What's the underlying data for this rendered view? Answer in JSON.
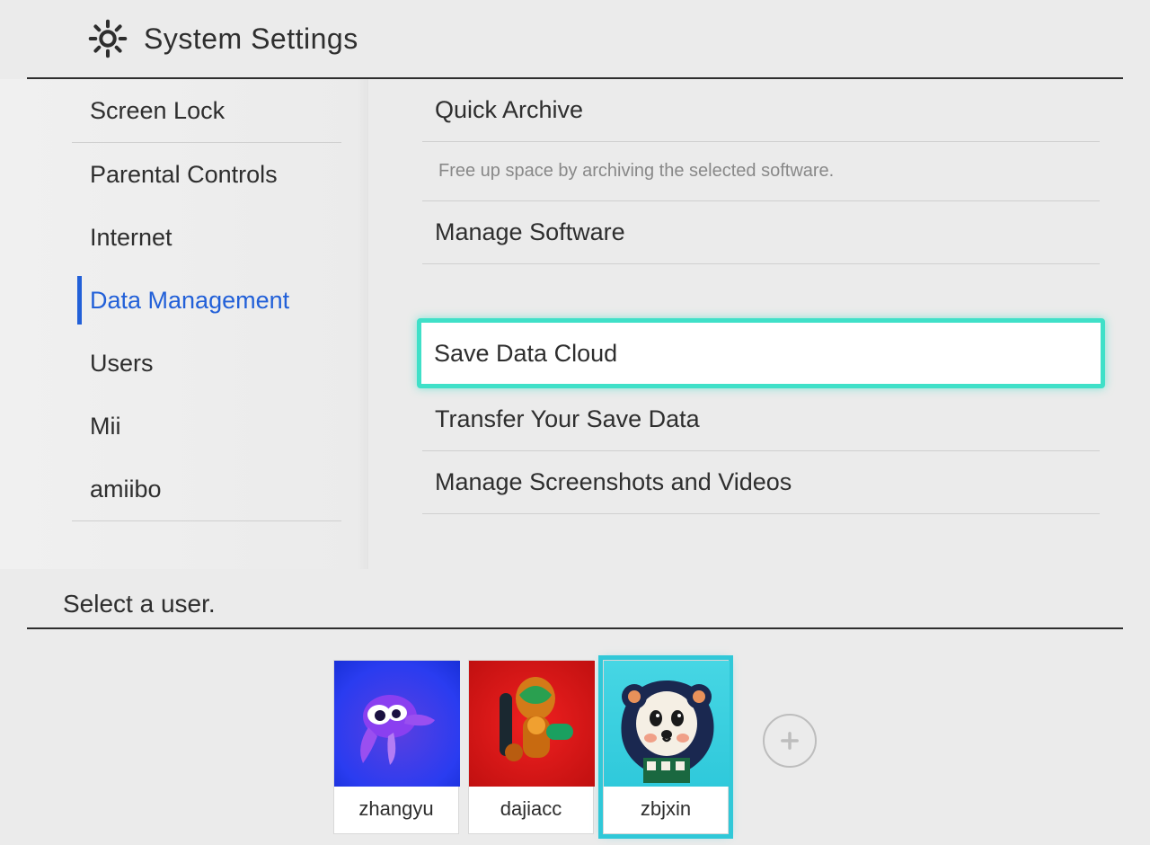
{
  "header": {
    "title": "System Settings"
  },
  "sidebar": {
    "items": [
      {
        "label": "Screen Lock",
        "divider_after": true
      },
      {
        "label": "Parental Controls"
      },
      {
        "label": "Internet"
      },
      {
        "label": "Data Management",
        "active": true
      },
      {
        "label": "Users"
      },
      {
        "label": "Mii"
      },
      {
        "label": "amiibo"
      }
    ]
  },
  "content": {
    "quick_archive": "Quick Archive",
    "quick_archive_desc": "Free up space by archiving the selected software.",
    "manage_software": "Manage Software",
    "save_data_cloud": "Save Data Cloud",
    "transfer_save": "Transfer Your Save Data",
    "manage_screenshots": "Manage Screenshots and Videos"
  },
  "user_select": {
    "prompt": "Select a user.",
    "users": [
      {
        "name": "zhangyu"
      },
      {
        "name": "dajiacc"
      },
      {
        "name": "zbjxin",
        "selected": true
      }
    ]
  },
  "colors": {
    "accent_blue": "#2260d8",
    "highlight_teal": "#3fe0c8"
  }
}
